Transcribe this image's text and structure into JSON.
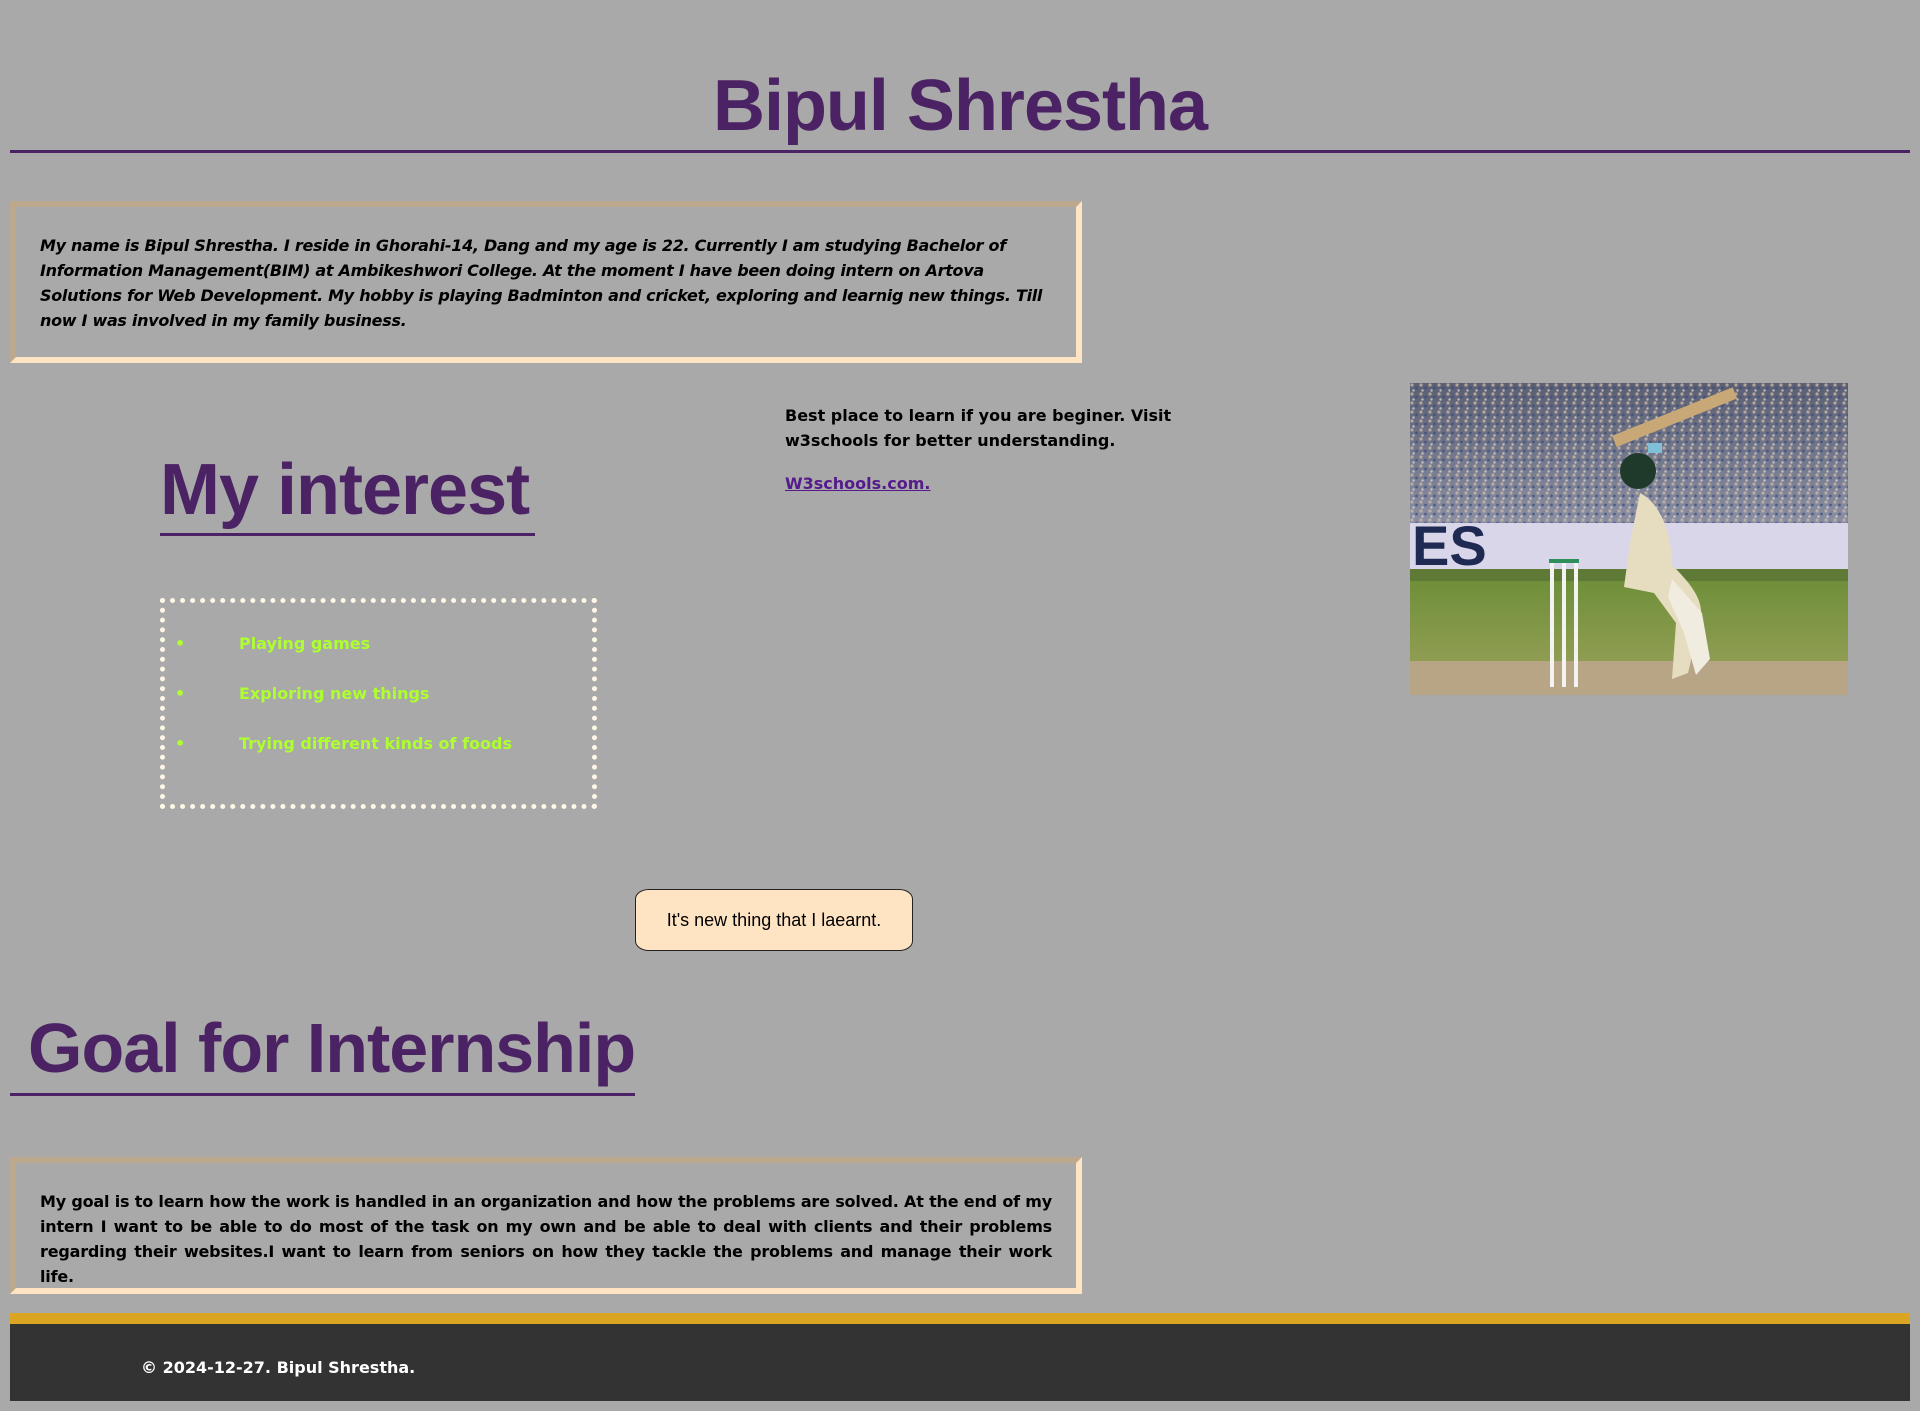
{
  "header": {
    "title": "Bipul Shrestha"
  },
  "about": {
    "text": "My name is Bipul Shrestha. I reside in Ghorahi-14, Dang and my age is 22. Currently I am studying Bachelor of Information Management(BIM) at Ambikeshwori College. At the moment I have been doing intern on Artova Solutions for Web Development. My hobby is playing Badminton and cricket, exploring and learnig new things. Till now I was involved in my family business."
  },
  "interest": {
    "heading": "My interest",
    "items": [
      {
        "bullet": "•",
        "label": "Playing games"
      },
      {
        "bullet": "•",
        "label": "Exploring new things"
      },
      {
        "bullet": "•",
        "label": "Trying different kinds of foods"
      }
    ]
  },
  "learn": {
    "text": "Best place to learn if you are beginer. Visit w3schools for better understanding.",
    "link_label": "W3schools.com."
  },
  "photo": {
    "image_icon": "cricket-batsman-photo"
  },
  "pill": {
    "label": "It's new thing that I laearnt."
  },
  "goal": {
    "heading": "Goal for Internship",
    "text": "My goal is to learn how the work is handled in an organization and how the problems are solved. At the end of my intern I want to be able to do most of the task on my own and be able to deal with clients and their problems regarding their websites.I want to learn from seniors on how they tackle the problems and manage their work life."
  },
  "footer": {
    "text": "© 2024-12-27. Bipul Shrestha."
  },
  "colors": {
    "background": "#a9a9a9",
    "heading": "#4b2263",
    "interest_text": "#adff2f",
    "link": "#551a8b",
    "pill_bg": "#ffe4c4",
    "footer_bg": "#333333",
    "footer_border": "#daa520"
  }
}
